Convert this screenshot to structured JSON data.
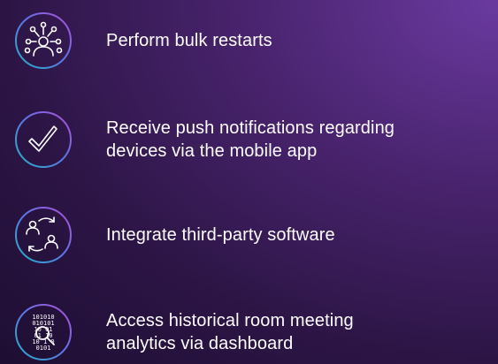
{
  "features": [
    {
      "icon": "network-people-icon",
      "lines": [
        "Perform bulk restarts"
      ]
    },
    {
      "icon": "checkmark-icon",
      "lines": [
        "Receive push notifications regarding",
        "devices via the mobile app"
      ]
    },
    {
      "icon": "people-exchange-icon",
      "lines": [
        "Integrate third-party software"
      ]
    },
    {
      "icon": "binary-magnifier-icon",
      "lines": [
        "Access historical room meeting",
        "analytics via dashboard"
      ]
    }
  ],
  "colors": {
    "ring_start": "#2aa7c9",
    "ring_mid": "#5b7fe0",
    "ring_end": "#b04fd6",
    "background": "#3a1c5c",
    "text": "#ffffff"
  }
}
